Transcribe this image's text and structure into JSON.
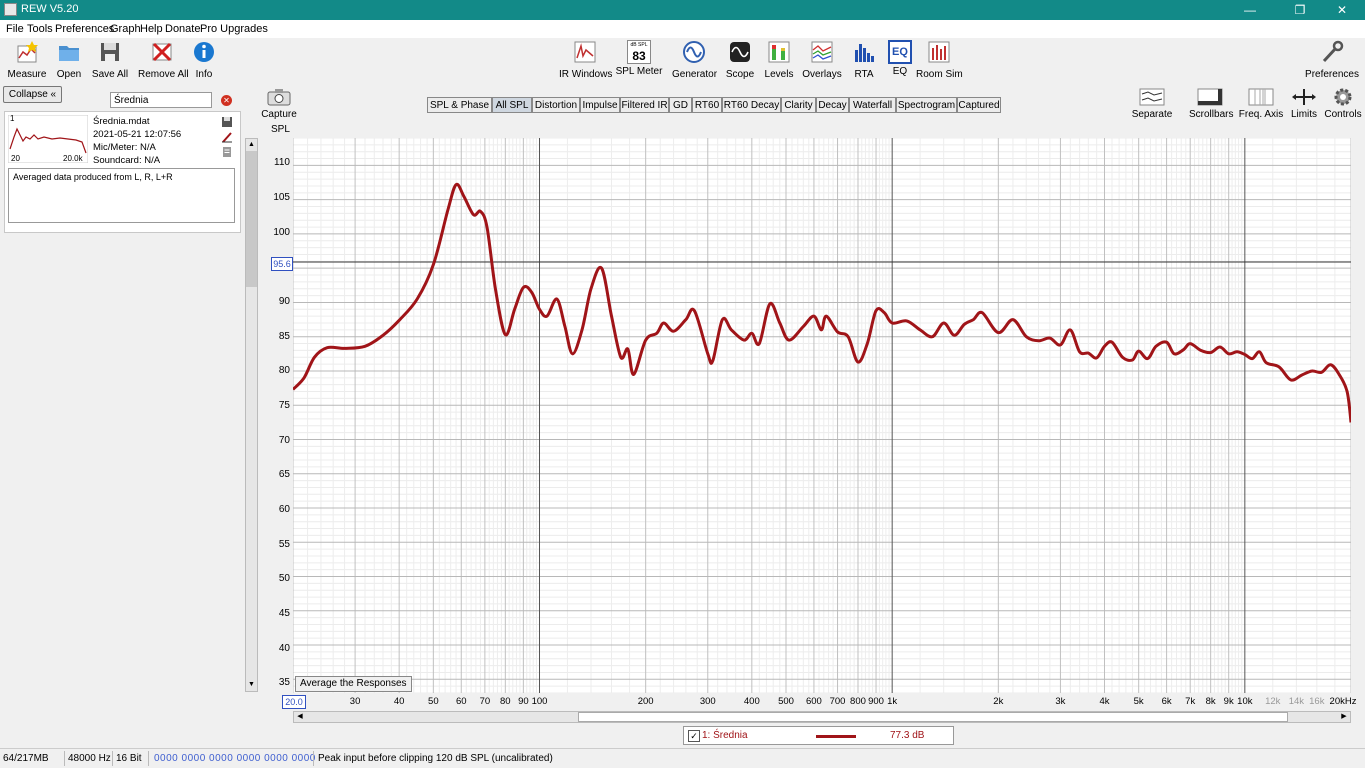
{
  "window": {
    "title": "REW V5.20",
    "minimize": "—",
    "maximize": "❐",
    "close": "✕"
  },
  "menu": [
    "File",
    "Tools",
    "Preferences",
    "Graph",
    "Help",
    "Donate",
    "Pro Upgrades"
  ],
  "toolbar_left": [
    {
      "label": "Measure",
      "icon": "measure-icon"
    },
    {
      "label": "Open",
      "icon": "folder-icon"
    },
    {
      "label": "Save All",
      "icon": "save-icon"
    },
    {
      "label": "Remove All",
      "icon": "remove-icon"
    },
    {
      "label": "Info",
      "icon": "info-icon"
    }
  ],
  "toolbar_center": [
    {
      "label": "IR Windows",
      "icon": "ir-windows-icon"
    },
    {
      "label": "SPL Meter",
      "icon": "spl-meter-icon",
      "badge_top": "dB SPL",
      "badge_value": "83"
    },
    {
      "label": "Generator",
      "icon": "generator-icon"
    },
    {
      "label": "Scope",
      "icon": "scope-icon"
    },
    {
      "label": "Levels",
      "icon": "levels-icon"
    },
    {
      "label": "Overlays",
      "icon": "overlays-icon"
    },
    {
      "label": "RTA",
      "icon": "rta-icon"
    },
    {
      "label": "EQ",
      "icon": "eq-icon",
      "badge_value": "EQ"
    },
    {
      "label": "Room Sim",
      "icon": "room-sim-icon"
    }
  ],
  "toolbar_right": {
    "label": "Preferences",
    "icon": "wrench-icon"
  },
  "left_panel": {
    "collapse_label": "Collapse «",
    "filter_value": "Średnia",
    "measurement": {
      "index": "1",
      "thumb_x_start": "20",
      "thumb_x_end": "20.0k",
      "name": "Średnia.mdat",
      "date": "2021-05-21 12:07:56",
      "mic": "Mic/Meter: N/A",
      "soundcard": "Soundcard: N/A",
      "notes": "Averaged data produced from L, R, L+R"
    }
  },
  "graph_tabs": [
    "SPL & Phase",
    "All SPL",
    "Distortion",
    "Impulse",
    "Filtered IR",
    "GD",
    "RT60",
    "RT60 Decay",
    "Clarity",
    "Decay",
    "Waterfall",
    "Spectrogram",
    "Captured"
  ],
  "active_tab": "All SPL",
  "capture": {
    "label": "Capture",
    "icon": "camera-icon"
  },
  "graph_tools": [
    {
      "label": "Separate",
      "icon": "separate-icon"
    },
    {
      "label": "Scrollbars",
      "icon": "scrollbars-icon"
    },
    {
      "label": "Freq. Axis",
      "icon": "freq-axis-icon"
    },
    {
      "label": "Limits",
      "icon": "limits-icon"
    },
    {
      "label": "Controls",
      "icon": "gear-icon"
    }
  ],
  "average_button": "Average the Responses",
  "cursor_value": "95.6",
  "x_start_value": "20.0",
  "legend": {
    "checked": true,
    "label": "1: Średnia",
    "value": "77.3 dB",
    "color": "#a01418"
  },
  "status": {
    "memory": "64/217MB",
    "rate": "48000 Hz",
    "bits": "16 Bit",
    "levels": "0000 0000   0000 0000   0000 0000",
    "message": "Peak input before clipping 120 dB SPL (uncalibrated)"
  },
  "chart_data": {
    "type": "line",
    "ylabel": "SPL",
    "x_scale": "log",
    "xlim": [
      20,
      20000
    ],
    "ylim": [
      33,
      114
    ],
    "y_ticks": [
      "110",
      "105",
      "100",
      "95",
      "90",
      "85",
      "80",
      "75",
      "70",
      "65",
      "60",
      "55",
      "50",
      "45",
      "40",
      "35"
    ],
    "x_ticks": [
      "30",
      "40",
      "50",
      "60",
      "70",
      "80",
      "90",
      "100",
      "200",
      "300",
      "400",
      "500",
      "600",
      "700",
      "800",
      "900",
      "1k",
      "2k",
      "3k",
      "4k",
      "5k",
      "6k",
      "7k",
      "8k",
      "9k",
      "10k",
      "12k",
      "14k",
      "16k",
      "20kHz"
    ],
    "x_tick_values": [
      30,
      40,
      50,
      60,
      70,
      80,
      90,
      100,
      200,
      300,
      400,
      500,
      600,
      700,
      800,
      900,
      1000,
      2000,
      3000,
      4000,
      5000,
      6000,
      7000,
      8000,
      9000,
      10000,
      12000,
      14000,
      16000,
      20000
    ],
    "grid": true,
    "series": [
      {
        "name": "1: Średnia",
        "color": "#a01418",
        "points": [
          [
            20,
            77.3
          ],
          [
            21.5,
            79
          ],
          [
            23,
            82
          ],
          [
            25,
            83.4
          ],
          [
            28,
            83.3
          ],
          [
            32,
            83.6
          ],
          [
            36,
            85.2
          ],
          [
            40,
            87.4
          ],
          [
            45,
            90.5
          ],
          [
            50,
            95.5
          ],
          [
            55,
            103.5
          ],
          [
            58,
            107.2
          ],
          [
            61,
            105.5
          ],
          [
            65,
            102.8
          ],
          [
            68,
            103.3
          ],
          [
            71,
            101
          ],
          [
            75,
            92
          ],
          [
            80,
            85.3
          ],
          [
            85,
            89
          ],
          [
            90,
            92.2
          ],
          [
            95,
            91.5
          ],
          [
            100,
            89
          ],
          [
            105,
            88
          ],
          [
            112,
            90.5
          ],
          [
            118,
            86.5
          ],
          [
            124,
            82.5
          ],
          [
            132,
            86
          ],
          [
            140,
            92
          ],
          [
            150,
            95
          ],
          [
            160,
            88
          ],
          [
            170,
            82
          ],
          [
            178,
            83.2
          ],
          [
            185,
            79.5
          ],
          [
            200,
            84.5
          ],
          [
            215,
            85.5
          ],
          [
            225,
            87
          ],
          [
            240,
            85.8
          ],
          [
            260,
            87.5
          ],
          [
            275,
            88.8
          ],
          [
            300,
            82.5
          ],
          [
            310,
            81.5
          ],
          [
            330,
            87.5
          ],
          [
            350,
            86
          ],
          [
            380,
            84.5
          ],
          [
            400,
            85.5
          ],
          [
            420,
            84
          ],
          [
            450,
            89.8
          ],
          [
            480,
            87
          ],
          [
            510,
            84.5
          ],
          [
            560,
            86.5
          ],
          [
            600,
            88
          ],
          [
            630,
            86
          ],
          [
            650,
            88
          ],
          [
            700,
            85.7
          ],
          [
            750,
            85
          ],
          [
            800,
            81.3
          ],
          [
            850,
            84
          ],
          [
            900,
            88.8
          ],
          [
            950,
            88.5
          ],
          [
            1000,
            87
          ],
          [
            1100,
            87.3
          ],
          [
            1200,
            86
          ],
          [
            1300,
            85
          ],
          [
            1400,
            87
          ],
          [
            1500,
            85.2
          ],
          [
            1600,
            86.8
          ],
          [
            1700,
            87.5
          ],
          [
            1800,
            88.5
          ],
          [
            2000,
            85.6
          ],
          [
            2200,
            87.5
          ],
          [
            2400,
            85
          ],
          [
            2600,
            84.4
          ],
          [
            2800,
            84.8
          ],
          [
            3000,
            83.8
          ],
          [
            3200,
            86
          ],
          [
            3400,
            82.8
          ],
          [
            3600,
            82.6
          ],
          [
            3800,
            81.9
          ],
          [
            4000,
            83.6
          ],
          [
            4200,
            84.2
          ],
          [
            4500,
            82
          ],
          [
            4800,
            81.6
          ],
          [
            5000,
            82.9
          ],
          [
            5300,
            81.8
          ],
          [
            5600,
            83.6
          ],
          [
            6000,
            84.2
          ],
          [
            6300,
            82.5
          ],
          [
            6700,
            83.1
          ],
          [
            7000,
            84
          ],
          [
            7500,
            83
          ],
          [
            8000,
            82.7
          ],
          [
            8500,
            83.5
          ],
          [
            9000,
            82.5
          ],
          [
            9500,
            82.8
          ],
          [
            10000,
            82.4
          ],
          [
            10500,
            81.8
          ],
          [
            11000,
            82.8
          ],
          [
            11500,
            81.2
          ],
          [
            12500,
            80.6
          ],
          [
            13500,
            78.7
          ],
          [
            14500,
            79.4
          ],
          [
            15500,
            80
          ],
          [
            16500,
            79.8
          ],
          [
            17500,
            80.9
          ],
          [
            18500,
            79.5
          ],
          [
            19500,
            77
          ],
          [
            20000,
            72.5
          ]
        ]
      }
    ]
  }
}
